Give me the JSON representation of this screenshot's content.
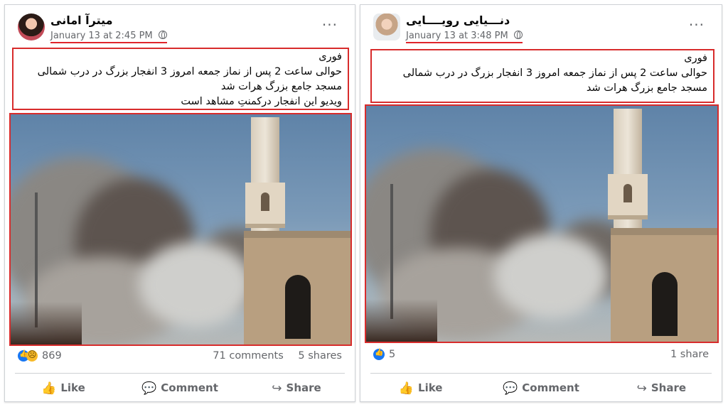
{
  "posts": [
    {
      "author": "میترآ امانی",
      "timestamp": "January 13 at 2:45 PM",
      "more_icon": "···",
      "text_lines": [
        "فوری",
        "حوالی ساعت 2 پس از نماز جمعه امروز 3  انفجار بزرگ در درب شمالی",
        "مسجد جامع بزرگ هرات شد",
        "ویدیو این انفجار درکمنتِ مشاهد است"
      ],
      "reaction_count": "869",
      "comments": "71 comments",
      "shares": "5 shares",
      "reactions": [
        "like",
        "sad"
      ]
    },
    {
      "author": "دنـــیایی رویــــایی",
      "timestamp": "January 13 at 3:48 PM",
      "more_icon": "···",
      "text_lines": [
        "فوری",
        "حوالی ساعت 2 پس از نماز جمعه امروز 3  انفجار بزرگ در درب شمالی",
        "مسجد جامع بزرگ هرات شد"
      ],
      "reaction_count": "5",
      "comments": "",
      "shares": "1 share",
      "reactions": [
        "like"
      ]
    }
  ],
  "actions": {
    "like": "Like",
    "comment": "Comment",
    "share": "Share"
  },
  "colors": {
    "highlight": "#d82c2c",
    "facebook_blue": "#1877f2",
    "meta_gray": "#65676b"
  }
}
